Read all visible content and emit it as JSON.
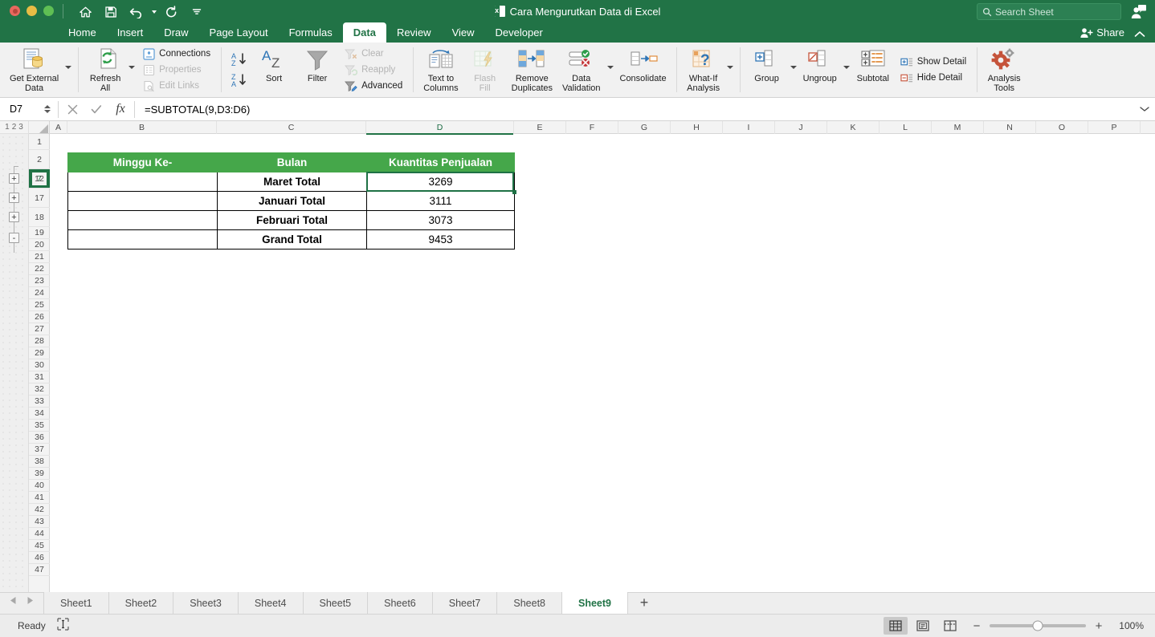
{
  "window": {
    "title": "Cara Mengurutkan Data di Excel",
    "app_icon": "excel-icon",
    "traffic_lights": [
      "close",
      "minimize",
      "maximize"
    ]
  },
  "quick_access": [
    {
      "name": "home-icon",
      "label": "Home"
    },
    {
      "name": "save-icon",
      "label": "Save"
    },
    {
      "name": "undo-icon",
      "label": "Undo"
    },
    {
      "name": "redo-icon",
      "label": "Redo"
    },
    {
      "name": "customize-icon",
      "label": "Customize Toolbar"
    }
  ],
  "search": {
    "placeholder": "Search Sheet",
    "icon": "search-icon"
  },
  "account": {
    "icon": "account-icon"
  },
  "ribbon_tabs": [
    {
      "label": "Home",
      "active": false
    },
    {
      "label": "Insert",
      "active": false
    },
    {
      "label": "Draw",
      "active": false
    },
    {
      "label": "Page Layout",
      "active": false
    },
    {
      "label": "Formulas",
      "active": false
    },
    {
      "label": "Data",
      "active": true
    },
    {
      "label": "Review",
      "active": false
    },
    {
      "label": "View",
      "active": false
    },
    {
      "label": "Developer",
      "active": false
    }
  ],
  "share": {
    "label": "Share",
    "icon": "share-person-icon"
  },
  "ribbon_collapse": {
    "icon": "chevron-up-icon"
  },
  "ribbon": {
    "get_external_data": {
      "label_line1": "Get External",
      "label_line2": "Data",
      "icon": "get-external-data-icon",
      "has_caret": true
    },
    "refresh_all": {
      "label_line1": "Refresh",
      "label_line2": "All",
      "icon": "refresh-all-icon",
      "has_caret": true
    },
    "connections_group": [
      {
        "label": "Connections",
        "icon": "connections-icon",
        "disabled": false
      },
      {
        "label": "Properties",
        "icon": "properties-icon",
        "disabled": true
      },
      {
        "label": "Edit Links",
        "icon": "edit-links-icon",
        "disabled": true
      }
    ],
    "sort_asc": {
      "icon": "sort-az-icon"
    },
    "sort_desc": {
      "icon": "sort-za-icon"
    },
    "sort": {
      "label": "Sort",
      "icon": "sort-icon"
    },
    "filter": {
      "label": "Filter",
      "icon": "filter-icon"
    },
    "filter_group": [
      {
        "label": "Clear",
        "icon": "clear-filter-icon",
        "disabled": true
      },
      {
        "label": "Reapply",
        "icon": "reapply-filter-icon",
        "disabled": true
      },
      {
        "label": "Advanced",
        "icon": "advanced-filter-icon",
        "disabled": false
      }
    ],
    "text_to_columns": {
      "label_line1": "Text to",
      "label_line2": "Columns",
      "icon": "text-to-columns-icon"
    },
    "flash_fill": {
      "label_line1": "Flash",
      "label_line2": "Fill",
      "icon": "flash-fill-icon",
      "disabled": true
    },
    "remove_duplicates": {
      "label_line1": "Remove",
      "label_line2": "Duplicates",
      "icon": "remove-duplicates-icon"
    },
    "data_validation": {
      "label_line1": "Data",
      "label_line2": "Validation",
      "icon": "data-validation-icon",
      "has_caret": true
    },
    "consolidate": {
      "label_line1": "Consolidate",
      "label_line2": "",
      "icon": "consolidate-icon"
    },
    "what_if": {
      "label_line1": "What-If",
      "label_line2": "Analysis",
      "icon": "what-if-icon",
      "has_caret": true
    },
    "group": {
      "label_line1": "Group",
      "label_line2": "",
      "icon": "group-icon",
      "has_caret": true
    },
    "ungroup": {
      "label_line1": "Ungroup",
      "label_line2": "",
      "icon": "ungroup-icon",
      "has_caret": true
    },
    "subtotal": {
      "label_line1": "Subtotal",
      "label_line2": "",
      "icon": "subtotal-icon"
    },
    "detail_group": [
      {
        "label": "Show Detail",
        "icon": "show-detail-icon"
      },
      {
        "label": "Hide Detail",
        "icon": "hide-detail-icon"
      }
    ],
    "analysis_tools": {
      "label_line1": "Analysis",
      "label_line2": "Tools",
      "icon": "analysis-tools-icon"
    }
  },
  "formula_bar": {
    "name_box": "D7",
    "cancel_icon": "cancel-icon",
    "enter_icon": "confirm-icon",
    "function_icon": "fx-icon",
    "formula": "=SUBTOTAL(9,D3:D6)",
    "expand_icon": "chevron-down-icon"
  },
  "outline": {
    "levels": [
      "1",
      "2",
      "3"
    ],
    "expand_buttons": [
      "+",
      "+",
      "+"
    ],
    "collapse_button": "-"
  },
  "grid": {
    "column_headers": [
      "A",
      "B",
      "C",
      "D",
      "E",
      "F",
      "G",
      "H",
      "I",
      "J",
      "K",
      "L",
      "M",
      "N",
      "O",
      "P"
    ],
    "selected_column": "D",
    "row_headers": [
      "1",
      "2",
      "7",
      "12",
      "17",
      "18",
      "19",
      "20",
      "21",
      "22",
      "23",
      "24",
      "25",
      "26",
      "27",
      "28",
      "29",
      "30",
      "31",
      "32",
      "33",
      "34",
      "35",
      "36",
      "37",
      "38",
      "39",
      "40",
      "41",
      "42",
      "43",
      "44",
      "45",
      "46",
      "47"
    ],
    "selected_row": "7",
    "selected_cell": "D7"
  },
  "table": {
    "headers": [
      "Minggu Ke-",
      "Bulan",
      "Kuantitas Penjualan"
    ],
    "header_color": "#45a74a",
    "rows": [
      {
        "minggu": "",
        "bulan": "Maret Total",
        "kuantitas": "3269"
      },
      {
        "minggu": "",
        "bulan": "Januari Total",
        "kuantitas": "3111"
      },
      {
        "minggu": "",
        "bulan": "Februari Total",
        "kuantitas": "3073"
      },
      {
        "minggu": "",
        "bulan": "Grand Total",
        "kuantitas": "9453"
      }
    ]
  },
  "sheet_tabs": {
    "prev_icon": "triangle-left-icon",
    "next_icon": "triangle-right-icon",
    "tabs": [
      {
        "label": "Sheet1",
        "active": false
      },
      {
        "label": "Sheet2",
        "active": false
      },
      {
        "label": "Sheet3",
        "active": false
      },
      {
        "label": "Sheet4",
        "active": false
      },
      {
        "label": "Sheet5",
        "active": false
      },
      {
        "label": "Sheet6",
        "active": false
      },
      {
        "label": "Sheet7",
        "active": false
      },
      {
        "label": "Sheet8",
        "active": false
      },
      {
        "label": "Sheet9",
        "active": true
      }
    ],
    "add_label": "+"
  },
  "status_bar": {
    "status": "Ready",
    "selection_mode_icon": "selection-mode-icon",
    "views": [
      {
        "name": "normal-view",
        "icon": "grid-view-icon",
        "active": true
      },
      {
        "name": "page-layout-view",
        "icon": "page-layout-icon",
        "active": false
      },
      {
        "name": "page-break-view",
        "icon": "page-break-icon",
        "active": false
      }
    ],
    "zoom_out": "−",
    "zoom_in": "+",
    "zoom_level": "100%"
  }
}
